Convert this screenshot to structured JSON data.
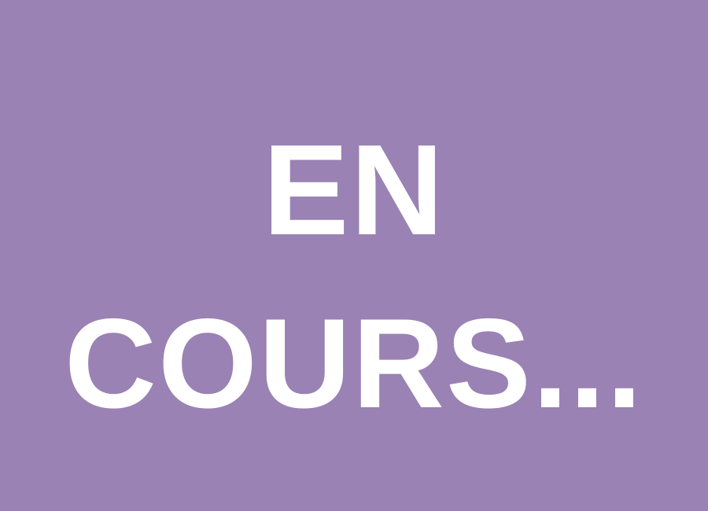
{
  "background_color": "#9a82b4",
  "text_color": "#ffffff",
  "status": {
    "line1": "EN",
    "line2": "COURS..."
  }
}
